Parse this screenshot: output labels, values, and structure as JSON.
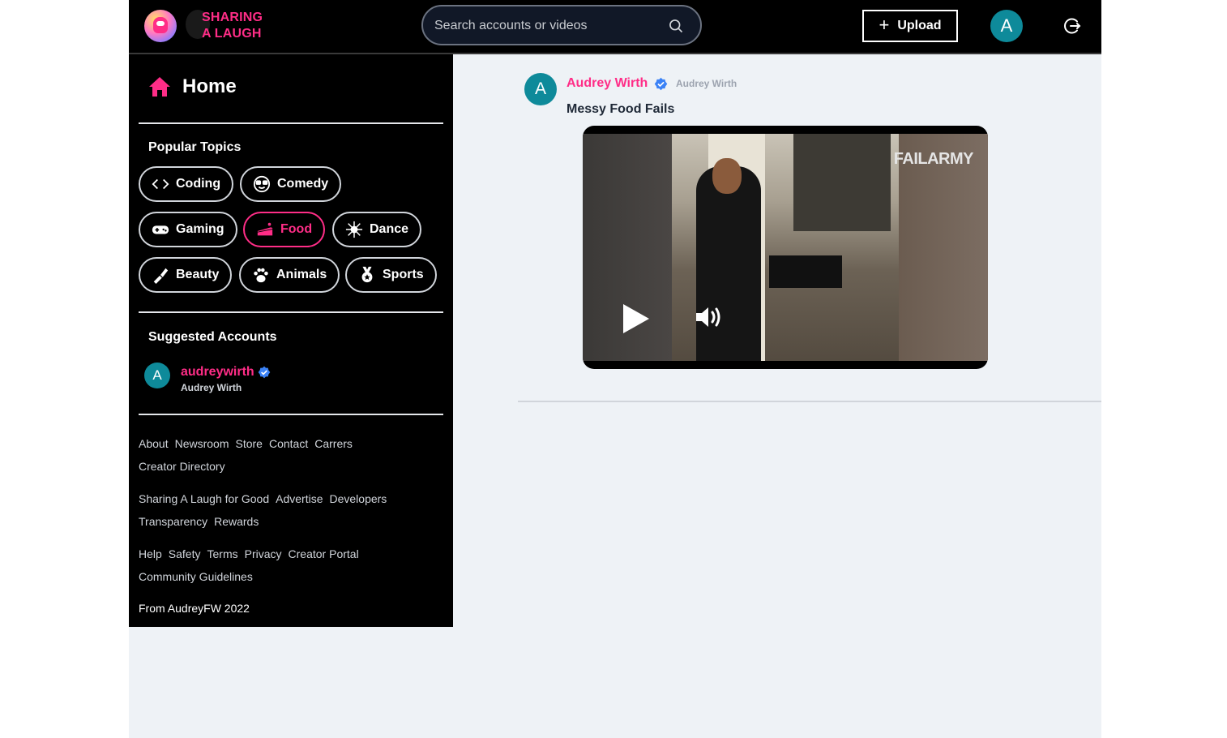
{
  "header": {
    "logo_line1": "SHARING",
    "logo_line2": "A LAUGH",
    "search_placeholder": "Search accounts or videos",
    "upload_label": "Upload",
    "avatar_initial": "A"
  },
  "sidebar": {
    "home_label": "Home",
    "topics_title": "Popular Topics",
    "topics": [
      {
        "label": "Coding",
        "icon": "code-icon"
      },
      {
        "label": "Comedy",
        "icon": "sunglasses-face-icon"
      },
      {
        "label": "Gaming",
        "icon": "gamepad-icon"
      },
      {
        "label": "Food",
        "icon": "cake-icon",
        "active": true
      },
      {
        "label": "Dance",
        "icon": "disco-ball-icon"
      },
      {
        "label": "Beauty",
        "icon": "lipstick-icon"
      },
      {
        "label": "Animals",
        "icon": "paw-icon"
      },
      {
        "label": "Sports",
        "icon": "medal-icon"
      }
    ],
    "suggested_title": "Suggested Accounts",
    "suggested": [
      {
        "initial": "A",
        "username": "audreywirth",
        "display_name": "Audrey Wirth",
        "verified": true
      }
    ],
    "links_group1": [
      "About",
      "Newsroom",
      "Store",
      "Contact",
      "Carrers",
      "Creator Directory"
    ],
    "links_group2": [
      "Sharing A Laugh for Good",
      "Advertise",
      "Developers",
      "Transparency",
      "Rewards"
    ],
    "links_group3": [
      "Help",
      "Safety",
      "Terms",
      "Privacy",
      "Creator Portal",
      "Community Guidelines"
    ],
    "footer": "From AudreyFW 2022"
  },
  "feed": {
    "posts": [
      {
        "initial": "A",
        "author": "Audrey Wirth",
        "author_sub": "Audrey Wirth",
        "verified": true,
        "caption": "Messy Food Fails",
        "video_watermark": "FAILARMY"
      }
    ]
  },
  "colors": {
    "accent": "#ff2d87",
    "avatar": "#0e8a9a",
    "verified": "#3b82f6",
    "sidebar_bg": "#000000",
    "feed_bg": "#eef2f6"
  }
}
